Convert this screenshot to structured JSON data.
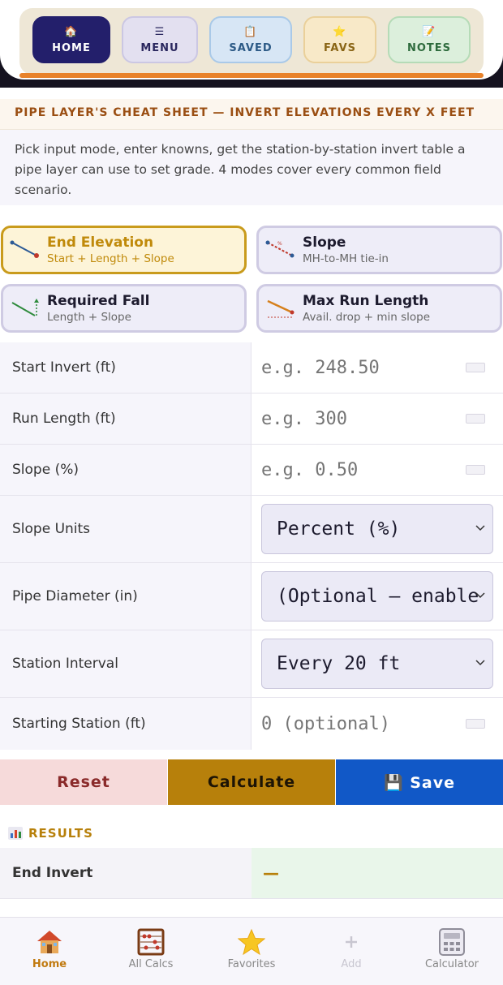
{
  "topnav": {
    "items": [
      {
        "label": "HOME",
        "icon": "🏠"
      },
      {
        "label": "MENU",
        "icon": "☰"
      },
      {
        "label": "SAVED",
        "icon": "📋"
      },
      {
        "label": "FAVS",
        "icon": "⭐"
      },
      {
        "label": "NOTES",
        "icon": "📝"
      }
    ]
  },
  "header": {
    "title": "PIPE LAYER'S CHEAT SHEET — INVERT ELEVATIONS EVERY X FEET",
    "intro": "Pick input mode, enter knowns, get the station-by-station invert table a pipe layer can use to set grade. 4 modes cover every common field scenario."
  },
  "modes": [
    {
      "name": "End Elevation",
      "sub": "Start + Length + Slope",
      "active": true
    },
    {
      "name": "Slope",
      "sub": "MH-to-MH tie-in",
      "active": false
    },
    {
      "name": "Required Fall",
      "sub": "Length + Slope",
      "active": false
    },
    {
      "name": "Max Run Length",
      "sub": "Avail. drop + min slope",
      "active": false
    }
  ],
  "form": {
    "start_invert": {
      "label": "Start Invert (ft)",
      "placeholder": "e.g. 248.50"
    },
    "run_length": {
      "label": "Run Length (ft)",
      "placeholder": "e.g. 300"
    },
    "slope": {
      "label": "Slope (%)",
      "placeholder": "e.g. 0.50"
    },
    "slope_units": {
      "label": "Slope Units",
      "value": "Percent (%)"
    },
    "pipe_diameter": {
      "label": "Pipe Diameter (in)",
      "value": "(Optional — enable"
    },
    "station_interval": {
      "label": "Station Interval",
      "value": "Every 20 ft"
    },
    "starting_station": {
      "label": "Starting Station (ft)",
      "placeholder": "0 (optional)"
    }
  },
  "actions": {
    "reset": "Reset",
    "calculate": "Calculate",
    "save": "💾 Save"
  },
  "results": {
    "title": "RESULTS",
    "rows": [
      {
        "label": "End Invert",
        "value": "—"
      }
    ]
  },
  "bottomnav": {
    "items": [
      {
        "label": "Home"
      },
      {
        "label": "All Calcs"
      },
      {
        "label": "Favorites"
      },
      {
        "label": "Add"
      },
      {
        "label": "Calculator"
      }
    ]
  },
  "colors": {
    "accent": "#b7800b",
    "primary_nav": "#231f6b",
    "save_blue": "#1158c7",
    "orange_bar": "#e8822a"
  }
}
